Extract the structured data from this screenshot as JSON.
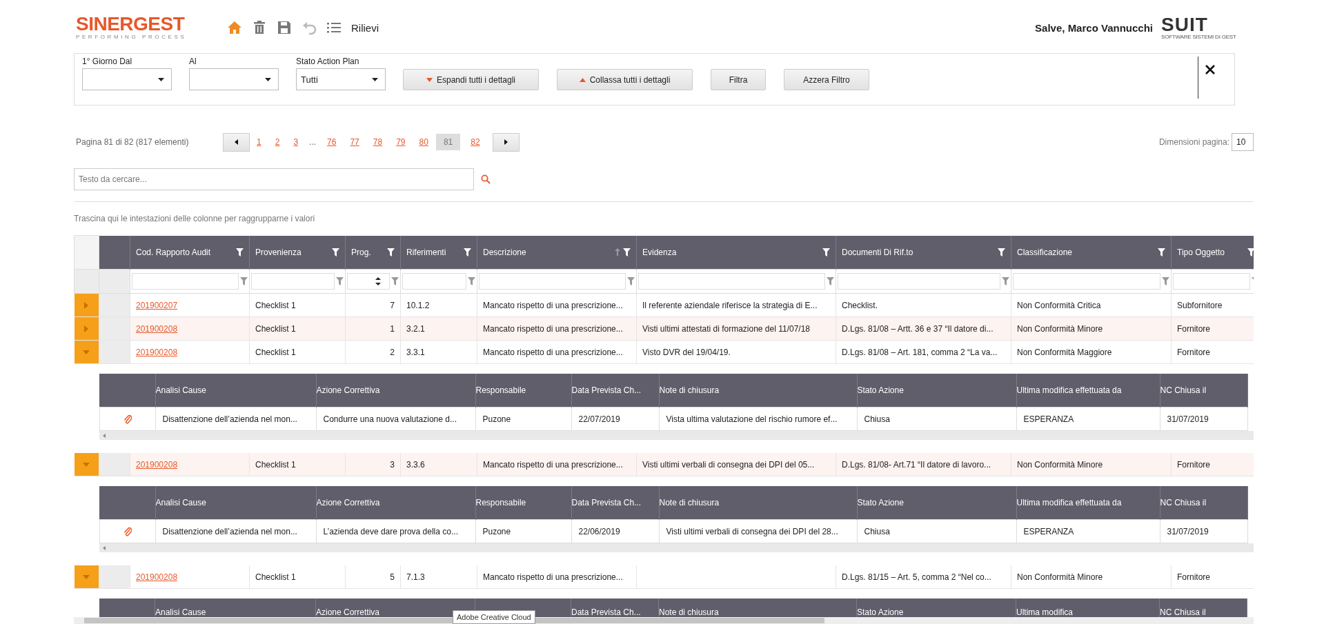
{
  "header": {
    "logo": {
      "name": "SINERGEST",
      "tagline": "PERFORMING PROCESS"
    },
    "toolbar": [
      {
        "kind": "home",
        "selected": true,
        "disabled": false
      },
      {
        "kind": "delete",
        "selected": false,
        "disabled": false
      },
      {
        "kind": "save",
        "selected": false,
        "disabled": false
      },
      {
        "kind": "undo",
        "selected": false,
        "disabled": true
      },
      {
        "kind": "list",
        "selected": false,
        "disabled": false
      }
    ],
    "section": "Rilievi",
    "greeting": "Salve, Marco Vannucchi",
    "brand": {
      "name": "SUIT",
      "tagline": "SOFTWARE SISTEMI DI GEST"
    }
  },
  "filters": {
    "fields": [
      {
        "label": "1° Giorno Dal"
      },
      {
        "label": "Al"
      },
      {
        "label": "Stato Action Plan",
        "value": "Tutti"
      }
    ],
    "buttons": [
      {
        "label": "Espandi tutti i dettagli"
      },
      {
        "label": "Collassa tutti i dettagli"
      },
      {
        "label": "Filtra"
      },
      {
        "label": "Azzera Filtro"
      }
    ]
  },
  "pager": {
    "info": "Pagina 81 di 82 (817 elementi)",
    "pages": [
      {
        "label": "1",
        "kind": "link",
        "selected": false
      },
      {
        "label": "2",
        "kind": "link",
        "selected": false
      },
      {
        "label": "3",
        "kind": "link",
        "selected": false
      },
      {
        "label": "...",
        "kind": "ellipsis",
        "selected": false
      },
      {
        "label": "76",
        "kind": "link",
        "selected": false
      },
      {
        "label": "77",
        "kind": "link",
        "selected": false
      },
      {
        "label": "78",
        "kind": "link",
        "selected": false
      },
      {
        "label": "79",
        "kind": "link",
        "selected": false
      },
      {
        "label": "80",
        "kind": "link",
        "selected": false
      },
      {
        "label": "81",
        "kind": "link",
        "selected": true
      },
      {
        "label": "82",
        "kind": "link",
        "selected": false
      }
    ],
    "page_size": {
      "label": "Dimensioni pagina:",
      "value": "10"
    }
  },
  "search": {
    "placeholder": "Testo da cercare..."
  },
  "group_panel": "Trascina qui le intestazioni delle colonne per raggrupparne i valori",
  "grid": {
    "columns": [
      {
        "label": "Cod. Rapporto Audit",
        "kind": "link",
        "sorted": false
      },
      {
        "label": "Provenienza",
        "kind": "text",
        "sorted": false
      },
      {
        "label": "Prog.",
        "kind": "number",
        "sorted": false
      },
      {
        "label": "Riferimenti",
        "kind": "text",
        "sorted": false
      },
      {
        "label": "Descrizione",
        "kind": "text",
        "sorted": true
      },
      {
        "label": "Evidenza",
        "kind": "text",
        "sorted": false
      },
      {
        "label": "Documenti Di Rif.to",
        "kind": "text",
        "sorted": false
      },
      {
        "label": "Classificazione",
        "kind": "text",
        "sorted": false
      },
      {
        "label": "Tipo Oggetto",
        "kind": "text",
        "sorted": false
      }
    ],
    "rows": [
      {
        "expanded": false,
        "highlighted": false,
        "cells": [
          {
            "text": "201900207"
          },
          {
            "text": "Checklist 1"
          },
          {
            "text": "7"
          },
          {
            "text": "10.1.2"
          },
          {
            "text": "Mancato rispetto di una prescrizione..."
          },
          {
            "text": "Il referente aziendale riferisce la strategia di E..."
          },
          {
            "text": "Checklist."
          },
          {
            "text": "Non Conformità Critica"
          },
          {
            "text": "Subfornitore"
          }
        ]
      },
      {
        "expanded": false,
        "highlighted": true,
        "cells": [
          {
            "text": "201900208"
          },
          {
            "text": "Checklist 1"
          },
          {
            "text": "1"
          },
          {
            "text": "3.2.1"
          },
          {
            "text": "Mancato rispetto di una prescrizione..."
          },
          {
            "text": "Visti ultimi attestati di formazione del 11/07/18"
          },
          {
            "text": "D.Lgs. 81/08 – Artt. 36 e 37 “Il datore di..."
          },
          {
            "text": "Non Conformità Minore"
          },
          {
            "text": "Fornitore"
          }
        ]
      },
      {
        "expanded": true,
        "highlighted": false,
        "cells": [
          {
            "text": "201900208"
          },
          {
            "text": "Checklist 1"
          },
          {
            "text": "2"
          },
          {
            "text": "3.3.1"
          },
          {
            "text": "Mancato rispetto di una prescrizione..."
          },
          {
            "text": "Visto DVR del 19/04/19."
          },
          {
            "text": "D.Lgs. 81/08 – Art. 181, comma 2 “La va..."
          },
          {
            "text": "Non Conformità Maggiore"
          },
          {
            "text": "Fornitore"
          }
        ],
        "detail": {
          "columns": [
            {
              "label": "Analisi Cause"
            },
            {
              "label": "Azione Correttiva"
            },
            {
              "label": "Responsabile"
            },
            {
              "label": "Data Prevista Ch..."
            },
            {
              "label": "Note di chiusura"
            },
            {
              "label": "Stato Azione"
            },
            {
              "label": "Ultima modifica effettuata da"
            },
            {
              "label": "NC Chiusa il"
            }
          ],
          "rows": [
            {
              "attachment": true,
              "cells": [
                "Disattenzione dell’azienda nel mon...",
                "Condurre una nuova valutazione d...",
                "Puzone",
                "22/07/2019",
                "Vista ultima valutazione del rischio rumore ef...",
                "Chiusa",
                "ESPERANZA",
                "31/07/2019"
              ]
            }
          ]
        }
      },
      {
        "expanded": true,
        "highlighted": true,
        "cells": [
          {
            "text": "201900208"
          },
          {
            "text": "Checklist 1"
          },
          {
            "text": "3"
          },
          {
            "text": "3.3.6"
          },
          {
            "text": "Mancato rispetto di una prescrizione..."
          },
          {
            "text": "Visti ultimi verbali di consegna dei DPI del 05..."
          },
          {
            "text": "D.Lgs. 81/08- Art.71 “Il datore di lavoro..."
          },
          {
            "text": "Non Conformità Minore"
          },
          {
            "text": "Fornitore"
          }
        ],
        "detail": {
          "columns": [
            {
              "label": "Analisi Cause"
            },
            {
              "label": "Azione Correttiva"
            },
            {
              "label": "Responsabile"
            },
            {
              "label": "Data Prevista Ch..."
            },
            {
              "label": "Note di chiusura"
            },
            {
              "label": "Stato Azione"
            },
            {
              "label": "Ultima modifica effettuata da"
            },
            {
              "label": "NC Chiusa il"
            }
          ],
          "rows": [
            {
              "attachment": true,
              "cells": [
                "Disattenzione dell’azienda nel mon...",
                "L’azienda deve dare prova della co...",
                "Puzone",
                "22/06/2019",
                "Visti ultimi verbali di consegna dei DPI del 28...",
                "Chiusa",
                "ESPERANZA",
                "31/07/2019"
              ]
            }
          ]
        }
      },
      {
        "expanded": true,
        "highlighted": false,
        "cells": [
          {
            "text": "201900208"
          },
          {
            "text": "Checklist 1"
          },
          {
            "text": "5"
          },
          {
            "text": "7.1.3"
          },
          {
            "text": "Mancato rispetto di una prescrizione..."
          },
          {},
          {
            "text": "D.Lgs. 81/15 – Art. 5, comma 2 “Nel co..."
          },
          {
            "text": "Non Conformità Minore"
          },
          {
            "text": "Fornitore"
          }
        ],
        "detail": {
          "columns": [
            {
              "label": "Analisi Cause"
            },
            {
              "label": "Azione Correttiva"
            },
            {},
            {
              "label": "Data Prevista Ch..."
            },
            {
              "label": "Note di chiusura"
            },
            {
              "label": "Stato Azione"
            },
            {
              "label": "Ultima modifica"
            },
            {
              "label": "NC Chiusa il"
            }
          ]
        }
      }
    ]
  },
  "tooltip": "Adobe Creative Cloud"
}
